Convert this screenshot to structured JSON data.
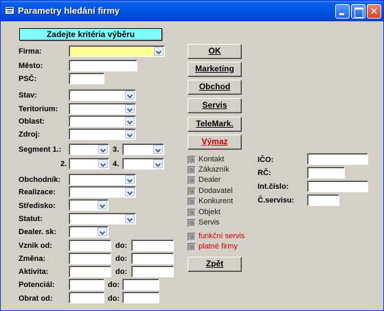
{
  "window": {
    "title": "Parametry hledání firmy",
    "controls": [
      "minimize",
      "maximize",
      "close"
    ]
  },
  "header": {
    "text": "Zadejte kritéria výběru"
  },
  "fields": {
    "firma": "Firma:",
    "mesto": "Město:",
    "psc": "PSČ:",
    "stav": "Stav:",
    "teritorium": "Teritorium:",
    "oblast": "Oblast:",
    "zdroj": "Zdroj:",
    "segment1": "Segment 1.:",
    "segment2": "2.",
    "segment3": "3.",
    "segment4": "4.",
    "obchodnik": "Obchodník:",
    "realizace": "Realizace:",
    "stredisko": "Středisko:",
    "statut": "Statut:",
    "dealer_sk": "Dealer. sk:",
    "vznik_od": "Vznik od:",
    "zmena": "Změna:",
    "aktivita": "Aktivita:",
    "potencial": "Potenciál:",
    "obrat_od": "Obrat od:",
    "do": "do:",
    "ico": "IČO:",
    "rc": "RČ:",
    "int_cislo": "Int.číslo:",
    "c_servisu": "Č.servisu:"
  },
  "buttons": {
    "ok": "OK",
    "marketing": "Marketing",
    "obchod": "Obchod",
    "servis": "Servis",
    "telemark": "TeleMark.",
    "vymaz": "Výmaz",
    "zpet": "Zpět"
  },
  "checkboxes": {
    "type_filters": [
      "Kontakt",
      "Zákazník",
      "Dealer",
      "Dodavatel",
      "Konkurent",
      "Objekt",
      "Servis"
    ],
    "funkcni_servis": "funkční servis",
    "platne_firmy": "platné firmy"
  },
  "colors": {
    "title_bar": "#0054e3",
    "header_box": "#80ffff",
    "firma_field": "#ffff99",
    "warning_text": "#d00000",
    "vymaz_text": "#c00000"
  }
}
